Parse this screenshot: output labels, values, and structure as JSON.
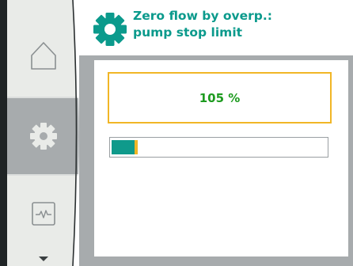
{
  "header": {
    "icon": "gear-icon",
    "title_line1": "Zero flow by overp.:",
    "title_line2": "pump stop limit"
  },
  "sidebar": {
    "items": [
      {
        "name": "home",
        "icon": "home-icon",
        "selected": false
      },
      {
        "name": "settings",
        "icon": "gear-icon",
        "selected": true
      },
      {
        "name": "diagnostics",
        "icon": "pulse-monitor-icon",
        "selected": false
      },
      {
        "name": "scroll-down",
        "icon": "triangle-down-icon",
        "selected": false
      }
    ]
  },
  "setting": {
    "value_display": "105 %",
    "bar_level": 0.12
  },
  "colors": {
    "accent": "#0b9a8c",
    "value_text": "#1e9b20",
    "focus_border": "#f1b626",
    "sidebar_selected": "#a7abad",
    "sidebar_bg": "#e9ebe8"
  }
}
